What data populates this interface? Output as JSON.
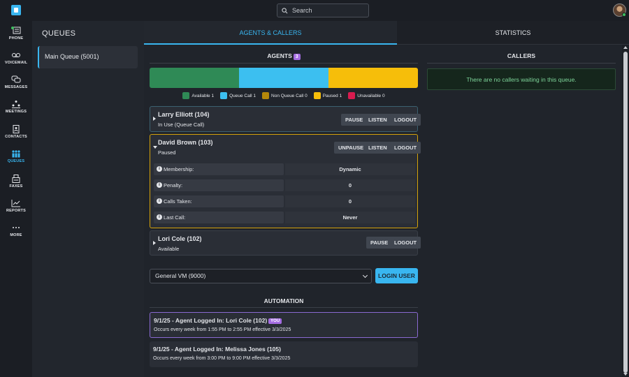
{
  "search": {
    "placeholder": "Search"
  },
  "nav": [
    {
      "label": "PHONE",
      "icon": "phone-icon"
    },
    {
      "label": "VOICEMAIL",
      "icon": "voicemail-icon"
    },
    {
      "label": "MESSAGES",
      "icon": "messages-icon"
    },
    {
      "label": "MEETINGS",
      "icon": "meetings-icon"
    },
    {
      "label": "CONTACTS",
      "icon": "contacts-icon"
    },
    {
      "label": "QUEUES",
      "icon": "queues-icon",
      "active": true
    },
    {
      "label": "FAXES",
      "icon": "fax-icon"
    },
    {
      "label": "REPORTS",
      "icon": "reports-icon"
    },
    {
      "label": "MORE",
      "icon": "more-icon"
    }
  ],
  "queues": {
    "title": "QUEUES",
    "items": [
      "Main Queue (5001)"
    ]
  },
  "tabs": [
    "AGENTS & CALLERS",
    "STATISTICS"
  ],
  "agents_section": {
    "title": "AGENTS",
    "count": "3"
  },
  "status_bar": {
    "segments": [
      {
        "value": 1,
        "color": "#2f8a56"
      },
      {
        "value": 1,
        "color": "#3cbff0"
      },
      {
        "value": 1,
        "color": "#f6be0a"
      }
    ]
  },
  "legend": [
    {
      "label": "Available 1",
      "color": "#2f8a56"
    },
    {
      "label": "Queue Call 1",
      "color": "#3cbff0"
    },
    {
      "label": "Non Queue Call 0",
      "color": "#b5880a"
    },
    {
      "label": "Paused 1",
      "color": "#f6be0a"
    },
    {
      "label": "Unavailable 0",
      "color": "#d81b4f"
    }
  ],
  "agents": [
    {
      "name": "Larry Elliott (104)",
      "status": "In Use (Queue Call)",
      "buttons": [
        "PAUSE",
        "LISTEN",
        "LOGOUT"
      ]
    },
    {
      "name": "David Brown (103)",
      "status": "Paused",
      "buttons": [
        "UNPAUSE",
        "LISTEN",
        "LOGOUT"
      ],
      "details": [
        {
          "k": "Membership:",
          "v": "Dynamic"
        },
        {
          "k": "Penalty:",
          "v": "0"
        },
        {
          "k": "Calls Taken:",
          "v": "0"
        },
        {
          "k": "Last Call:",
          "v": "Never"
        }
      ]
    },
    {
      "name": "Lori Cole (102)",
      "status": "Available",
      "buttons": [
        "PAUSE",
        "LOGOUT"
      ]
    }
  ],
  "login": {
    "selected": "General VM (9000)",
    "button": "LOGIN USER"
  },
  "automation": {
    "title": "AUTOMATION",
    "items": [
      {
        "title": "9/1/25 - Agent Logged In: Lori Cole (102)",
        "badge": "YOU",
        "desc": "Occurs every week from 1:55 PM to 2:55 PM effective 3/3/2025"
      },
      {
        "title": "9/1/25 - Agent Logged In: Melissa Jones (105)",
        "desc": "Occurs every week from 3:00 PM to 9:00 PM effective 3/3/2025"
      }
    ]
  },
  "callers": {
    "title": "CALLERS",
    "empty": "There are no callers waiting in this queue."
  }
}
